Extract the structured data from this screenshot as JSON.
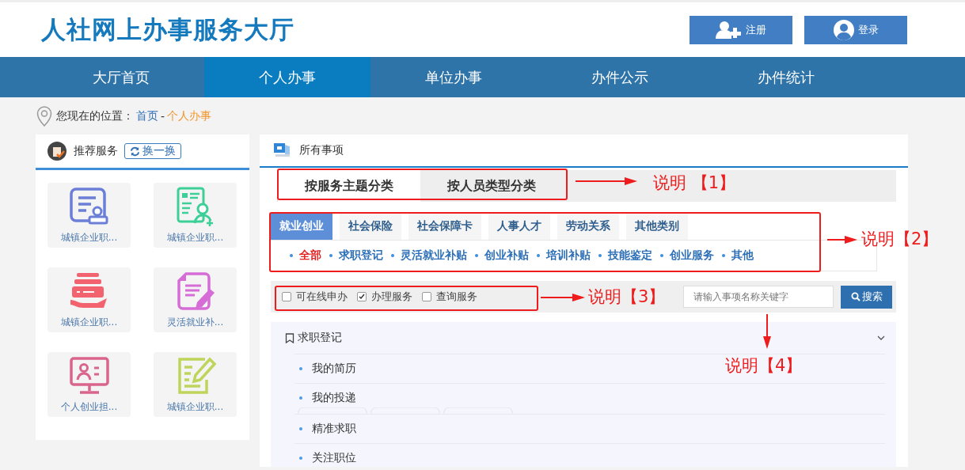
{
  "header": {
    "logo": "人社网上办事服务大厅",
    "buttons": [
      {
        "kind": "register",
        "label": "注册"
      },
      {
        "kind": "login",
        "label": "登录"
      }
    ]
  },
  "nav": [
    {
      "label": "大厅首页",
      "selected": false
    },
    {
      "label": "个人办事",
      "selected": true
    },
    {
      "label": "单位办事",
      "selected": false
    },
    {
      "label": "办件公示",
      "selected": false
    },
    {
      "label": "办件统计",
      "selected": false
    }
  ],
  "breadcrumb": {
    "prefix": "您现在的位置：",
    "home": "首页",
    "separator": "-",
    "current": "个人办事"
  },
  "recommended": {
    "title": "推荐服务",
    "refresh": "换一换",
    "tiles": [
      {
        "kind": "stamp",
        "label": "城镇企业职..."
      },
      {
        "kind": "resume",
        "label": "城镇企业职..."
      },
      {
        "kind": "tray",
        "label": "城镇企业职..."
      },
      {
        "kind": "note",
        "label": "灵活就业补..."
      },
      {
        "kind": "monitor",
        "label": "个人创业担..."
      },
      {
        "kind": "edit",
        "label": "城镇企业职..."
      }
    ]
  },
  "matters": {
    "title": "所有事项",
    "tabs": [
      {
        "label": "按服务主题分类",
        "selected": true
      },
      {
        "label": "按人员类型分类",
        "selected": false
      }
    ],
    "categories": [
      {
        "label": "就业创业",
        "selected": true
      },
      {
        "label": "社会保险",
        "selected": false
      },
      {
        "label": "社会保障卡",
        "selected": false
      },
      {
        "label": "人事人才",
        "selected": false
      },
      {
        "label": "劳动关系",
        "selected": false
      },
      {
        "label": "其他类别",
        "selected": false
      }
    ],
    "subcategories": [
      {
        "label": "全部",
        "selected": true
      },
      {
        "label": "求职登记",
        "selected": false
      },
      {
        "label": "灵活就业补贴",
        "selected": false
      },
      {
        "label": "创业补贴",
        "selected": false
      },
      {
        "label": "培训补贴",
        "selected": false
      },
      {
        "label": "技能鉴定",
        "selected": false
      },
      {
        "label": "创业服务",
        "selected": false
      },
      {
        "label": "其他",
        "selected": false
      }
    ],
    "filters": [
      {
        "label": "可在线申办",
        "checked": false
      },
      {
        "label": "办理服务",
        "checked": true
      },
      {
        "label": "查询服务",
        "checked": false
      }
    ],
    "search": {
      "placeholder": "请输入事项名称关键字",
      "button": "搜索"
    },
    "group": {
      "title": "求职登记",
      "expanded": true,
      "items": [
        {
          "label": "我的简历"
        },
        {
          "label": "我的投递",
          "kind": "tags"
        },
        {
          "label": "精准求职"
        },
        {
          "label": "关注职位"
        }
      ]
    }
  },
  "annotations": [
    {
      "label": "说明 【1】"
    },
    {
      "label": "说明【2】"
    },
    {
      "label": "说明【3】"
    },
    {
      "label": "说明【4】"
    }
  ]
}
